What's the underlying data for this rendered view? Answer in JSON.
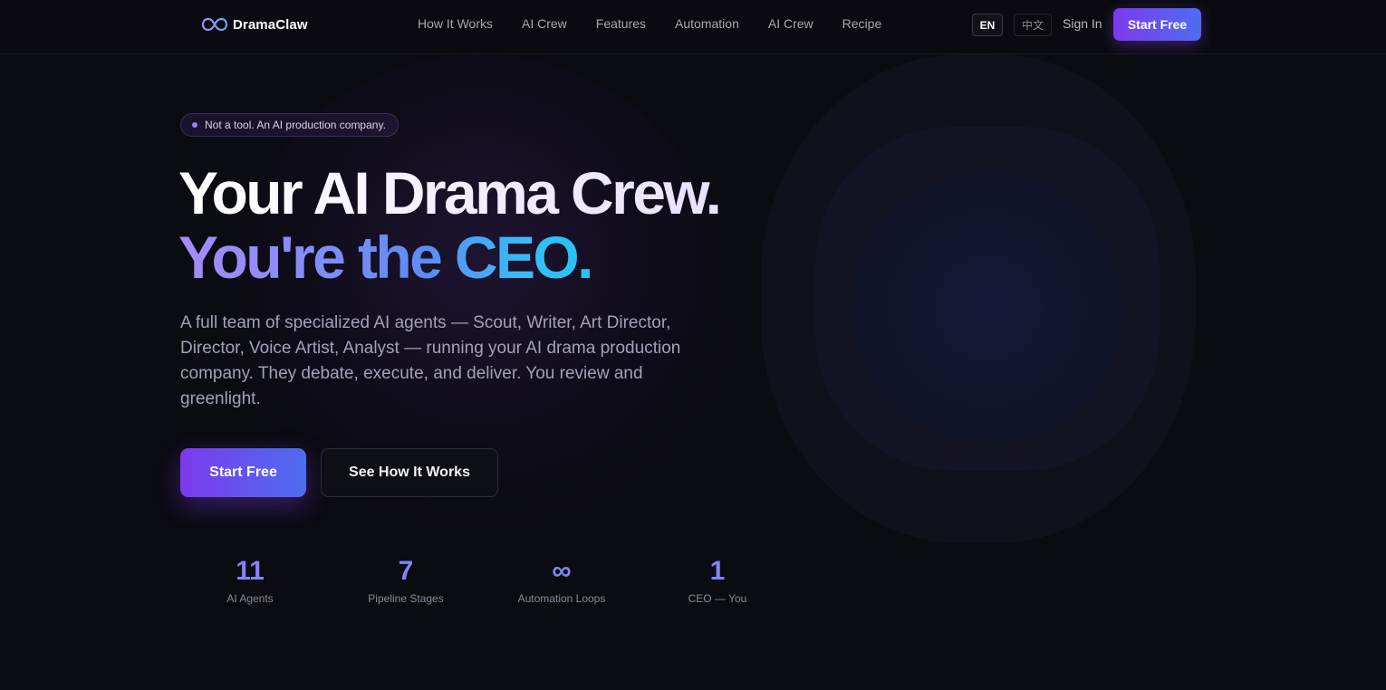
{
  "brand": {
    "name": "DramaClaw",
    "logo_icon": "infinity-loop-icon"
  },
  "nav": {
    "links": [
      "How It Works",
      "AI Crew",
      "Features",
      "Automation",
      "AI Crew",
      "Recipe"
    ],
    "lang_en": "EN",
    "lang_zh": "中文",
    "sign_in": "Sign In",
    "cta": "Start Free"
  },
  "hero": {
    "badge": "Not a tool. An AI production company.",
    "title_line1": "Your AI Drama Crew.",
    "title_line2": "You're the CEO.",
    "description": "A full team of specialized AI agents — Scout, Writer, Art Director, Director, Voice Artist, Analyst — running your AI drama production company. They debate, execute, and deliver. You review and greenlight.",
    "primary_cta": "Start Free",
    "secondary_cta": "See How It Works"
  },
  "stats": [
    {
      "value": "11",
      "label": "AI Agents"
    },
    {
      "value": "7",
      "label": "Pipeline Stages"
    },
    {
      "value": "∞",
      "label": "Automation Loops"
    },
    {
      "value": "1",
      "label": "CEO — You"
    }
  ],
  "colors": {
    "background": "#0b0b12",
    "accent_purple": "#7c3aed",
    "accent_blue": "#4f6cf0",
    "accent_cyan": "#22c5f0"
  }
}
